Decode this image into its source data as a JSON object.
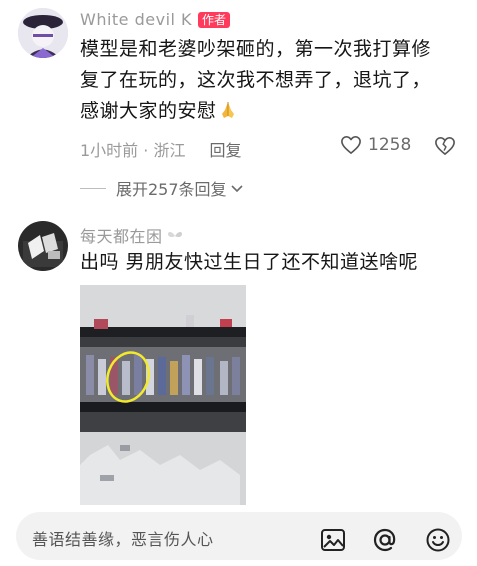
{
  "comments": [
    {
      "username": "White devil  K",
      "badge": "作者",
      "text_lines": [
        "模型是和老婆吵架砸的，第一次我打算修",
        "复了在玩的，这次我不想弄了，退坑了，",
        "感谢大家的安慰"
      ],
      "emoji": "pray-hands",
      "time_location": "1小时前 · 浙江",
      "reply_label": "回复",
      "likes": "1258",
      "expand_replies": "展开257条回复"
    },
    {
      "username": "每天都在困",
      "text": "出吗  男朋友快过生日了还不知道送啥呢"
    }
  ],
  "input_bar": {
    "placeholder": "善语结善缘，恶言伤人心",
    "icons": [
      "image-icon",
      "at-icon",
      "emoji-icon"
    ]
  },
  "colors": {
    "badge": "#ff3b5c",
    "meta_text": "#9a9a9a",
    "body_text": "#161616",
    "input_bg": "#f2f2f2"
  }
}
